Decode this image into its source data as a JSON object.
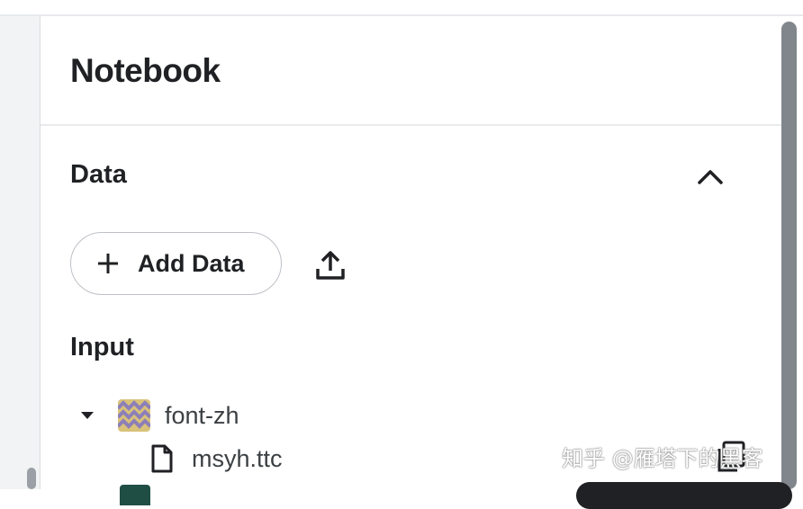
{
  "panel": {
    "title": "Notebook",
    "data_section": {
      "heading": "Data",
      "add_button_label": "Add Data",
      "input_heading": "Input",
      "tree": [
        {
          "label": "font-zh",
          "expanded": true,
          "children": [
            {
              "label": "msyh.ttc"
            }
          ]
        }
      ]
    }
  },
  "watermark": "知乎 @雁塔下的黑客",
  "icons": [
    "plus-icon",
    "upload-icon",
    "chevron-up-icon",
    "caret-down-icon",
    "dataset-icon",
    "file-icon",
    "copy-icon"
  ],
  "colors": {
    "text": "#202124",
    "muted_text": "#3c4043",
    "border": "#dadce0",
    "scrollbar": "#80868b"
  }
}
